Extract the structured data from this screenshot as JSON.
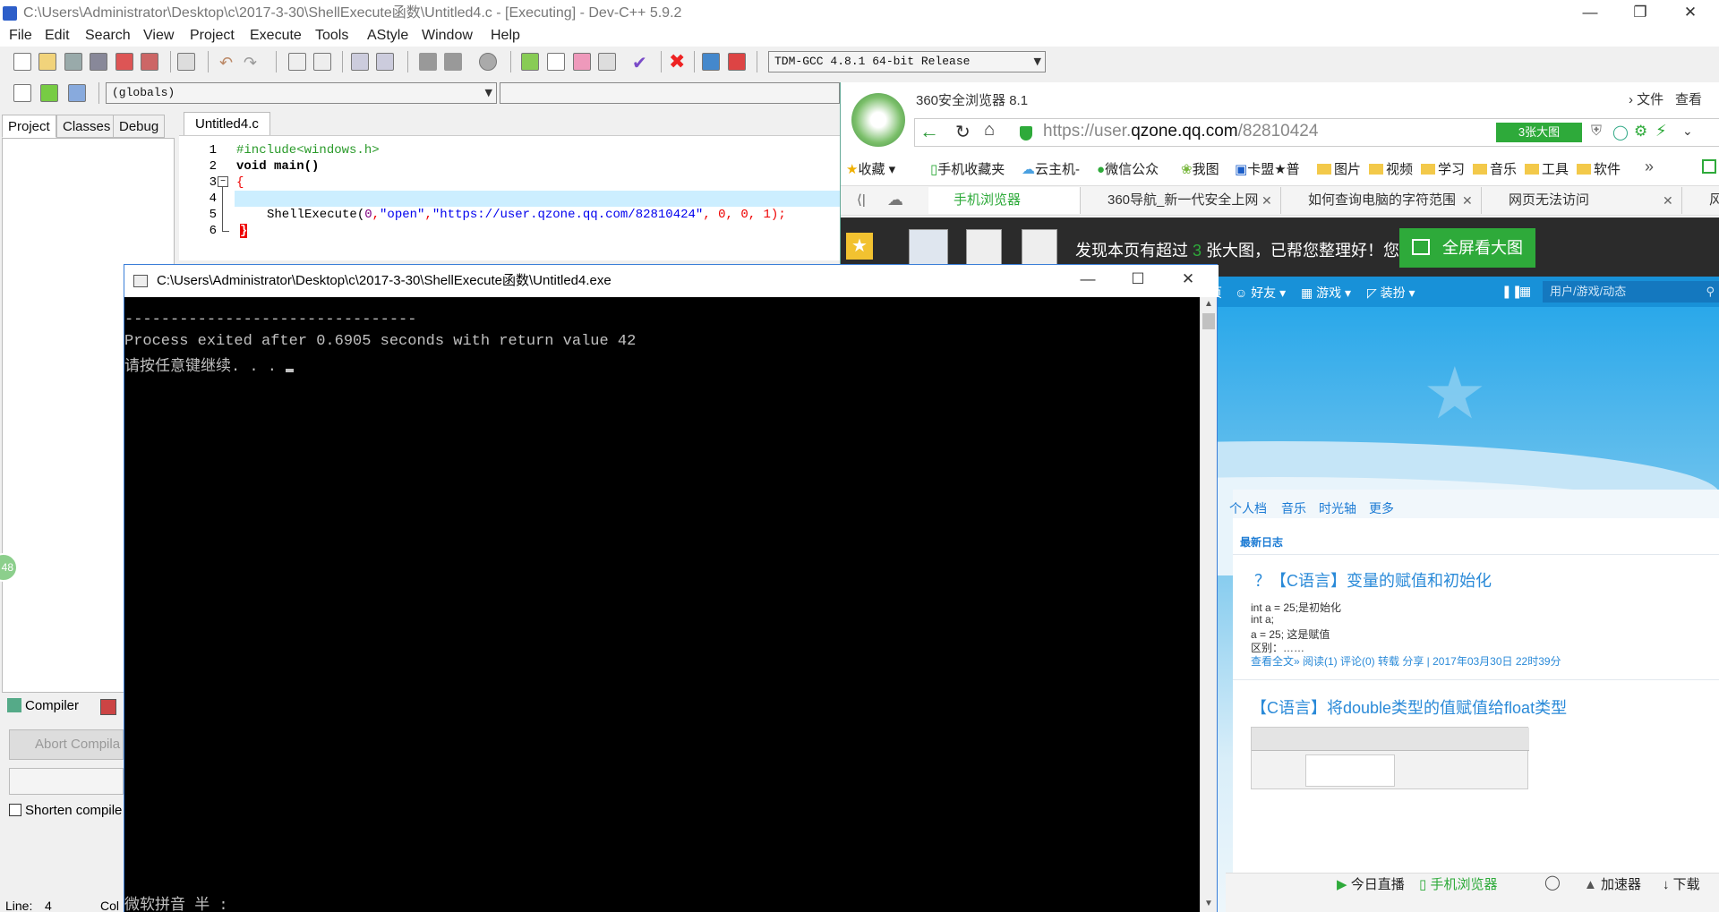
{
  "devcpp": {
    "title": "C:\\Users\\Administrator\\Desktop\\c\\2017-3-30\\ShellExecute函数\\Untitled4.c - [Executing] - Dev-C++ 5.9.2",
    "menu": [
      "File",
      "Edit",
      "Search",
      "View",
      "Project",
      "Execute",
      "Tools",
      "AStyle",
      "Window",
      "Help"
    ],
    "compiler_combo": "TDM-GCC 4.8.1 64-bit Release",
    "scope_combo": "(globals)",
    "left_tabs": [
      "Project",
      "Classes",
      "Debug"
    ],
    "file_tab": "Untitled4.c",
    "line_numbers": [
      "1",
      "2",
      "3",
      "4",
      "5",
      "6"
    ],
    "code": {
      "line1": "#include<windows.h>",
      "line2": "void main()",
      "line3": "{",
      "line5_func": "ShellExecute(",
      "line5_n0": "0",
      "line5_comma": ",",
      "line5_open": "\"open\"",
      "line5_url": "\"https://user.qzone.qq.com/82810424\"",
      "line5_rest": ", 0, 0, 1);",
      "line6": "}"
    },
    "compiler_tab": "Compiler",
    "abort_button": "Abort Compila",
    "shorten_checkbox": "Shorten compile",
    "status_line": "Line:",
    "status_line_value": "4",
    "status_col": "Col",
    "side_badge": "48"
  },
  "console": {
    "title": "C:\\Users\\Administrator\\Desktop\\c\\2017-3-30\\ShellExecute函数\\Untitled4.exe",
    "separator": "--------------------------------",
    "exit_line": "Process exited after 0.6905 seconds with return value 42",
    "prompt_line": "请按任意键继续. . . ",
    "ime_line": "微软拼音 半 :"
  },
  "browser": {
    "app_name": "360安全浏览器 8.1",
    "top_menu": [
      "文件",
      "查看"
    ],
    "url_prefix": "https://user.",
    "url_domain": "qzone.qq.com",
    "url_path": "/82810424",
    "big_image_badge": "3张大图",
    "bookmarks": [
      "收藏",
      "手机收藏夹",
      "云主机-",
      "微信公众",
      "我图",
      "卡盟★普",
      "图片",
      "视频",
      "学习",
      "音乐",
      "工具",
      "软件"
    ],
    "tabs": [
      "手机浏览器",
      "360导航_新一代安全上网",
      "如何查询电脑的字符范围",
      "网页无法访问",
      "风"
    ],
    "notice_prefix": "发现本页有超过 ",
    "notice_count": "3",
    "notice_suffix": " 张大图，已帮您整理好！您可以",
    "fullscreen_button": "全屏看大图",
    "qz_nav": [
      "页",
      "好友",
      "游戏",
      "装扮"
    ],
    "qz_search": "用户/游戏/动态",
    "qz_links": [
      "个人档",
      "音乐",
      "时光轴",
      "更多"
    ],
    "section_title": "最新日志",
    "post1": {
      "title": "？【C语言】变量的赋值和初始化",
      "lines": [
        "int a = 25;是初始化",
        "int a;",
        "a = 25; 这是赋值",
        "区别：……"
      ],
      "meta": "查看全文»  阅读(1)  评论(0)  转载  分享  |  2017年03月30日 22时39分"
    },
    "post2": {
      "title": "【C语言】将double类型的值赋值给float类型"
    },
    "status_items": [
      "今日直播",
      "手机浏览器",
      "加速器",
      "下载"
    ]
  },
  "colors": {
    "accent_green": "#2eaa3a",
    "qzone_blue": "#1891d8",
    "link_blue": "#2a8ad8"
  }
}
